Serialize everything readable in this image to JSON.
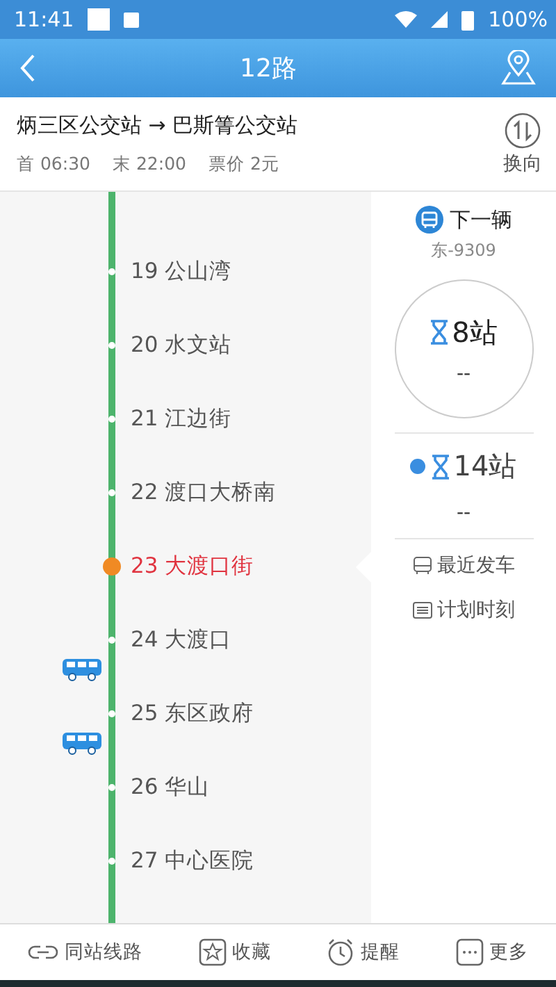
{
  "status_bar": {
    "time": "11:41",
    "battery": "100%"
  },
  "header": {
    "title": "12路"
  },
  "route": {
    "name": "炳三区公交站 → 巴斯箐公交站",
    "first": "首 06:30",
    "last": "末 22:00",
    "fare": "票价 2元",
    "reverse": "换向"
  },
  "stations": [
    {
      "label": "19 公山湾",
      "selected": false,
      "bus_after": false
    },
    {
      "label": "20 水文站",
      "selected": false,
      "bus_after": false
    },
    {
      "label": "21 江边街",
      "selected": false,
      "bus_after": false
    },
    {
      "label": "22 渡口大桥南",
      "selected": false,
      "bus_after": false
    },
    {
      "label": "23 大渡口街",
      "selected": true,
      "bus_after": false
    },
    {
      "label": "24 大渡口",
      "selected": false,
      "bus_after": true
    },
    {
      "label": "25 东区政府",
      "selected": false,
      "bus_after": true
    },
    {
      "label": "26 华山",
      "selected": false,
      "bus_after": false
    },
    {
      "label": "27 中心医院",
      "selected": false,
      "bus_after": false
    }
  ],
  "next_bus": {
    "title": "下一辆",
    "plate": "东-9309",
    "buses": [
      {
        "stops": "8站",
        "eta": "--"
      },
      {
        "stops": "14站",
        "eta": "--"
      }
    ],
    "links": [
      "最近发车",
      "计划时刻"
    ]
  },
  "bottom_nav": [
    "同站线路",
    "收藏",
    "提醒",
    "更多"
  ]
}
